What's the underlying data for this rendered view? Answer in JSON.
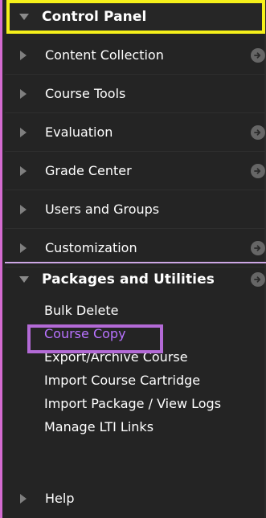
{
  "control_panel": {
    "title": "Control Panel"
  },
  "menu": {
    "items": [
      {
        "label": "Content Collection",
        "has_arrow": true
      },
      {
        "label": "Course Tools",
        "has_arrow": false
      },
      {
        "label": "Evaluation",
        "has_arrow": true
      },
      {
        "label": "Grade Center",
        "has_arrow": true
      },
      {
        "label": "Users and Groups",
        "has_arrow": false
      },
      {
        "label": "Customization",
        "has_arrow": true
      }
    ]
  },
  "packages": {
    "title": "Packages and Utilities",
    "items": [
      "Bulk Delete",
      "Course Copy",
      "Export/Archive Course",
      "Import Course Cartridge",
      "Import Package / View Logs",
      "Manage LTI Links"
    ],
    "active_index": 1
  },
  "help": {
    "label": "Help"
  },
  "colors": {
    "background": "#242424",
    "highlight_yellow": "#f5f01a",
    "highlight_purple": "#b36ad6",
    "active_link": "#b872ff",
    "left_accent": "#d46bd0"
  }
}
